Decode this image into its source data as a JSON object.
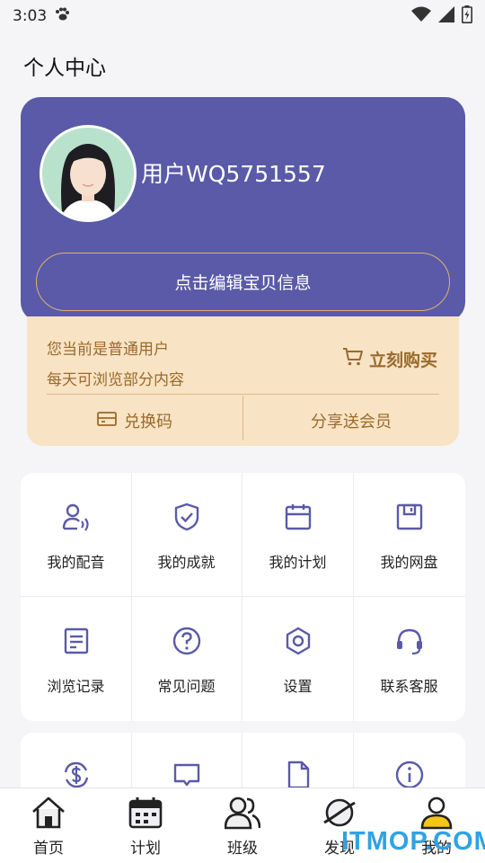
{
  "status_bar": {
    "time": "3:03"
  },
  "page": {
    "title": "个人中心"
  },
  "profile": {
    "username": "用户WQ5751557",
    "edit_button": "点击编辑宝贝信息"
  },
  "membership": {
    "status_line": "您当前是普通用户",
    "limit_line": "每天可浏览部分内容",
    "buy_label": "立刻购买",
    "redeem_label": "兑换码",
    "share_label": "分享送会员"
  },
  "menu_grid": [
    {
      "label": "我的配音",
      "icon": "dubbing-icon"
    },
    {
      "label": "我的成就",
      "icon": "shield-check-icon"
    },
    {
      "label": "我的计划",
      "icon": "calendar-icon"
    },
    {
      "label": "我的网盘",
      "icon": "save-disk-icon"
    },
    {
      "label": "浏览记录",
      "icon": "document-icon"
    },
    {
      "label": "常见问题",
      "icon": "question-icon"
    },
    {
      "label": "设置",
      "icon": "settings-hex-icon"
    },
    {
      "label": "联系客服",
      "icon": "headset-icon"
    }
  ],
  "menu_grid_2_icons": [
    "dollar-refresh-icon",
    "message-icon",
    "file-icon",
    "info-icon"
  ],
  "bottom_nav": [
    {
      "label": "首页",
      "icon": "home-icon"
    },
    {
      "label": "计划",
      "icon": "calendar-nav-icon"
    },
    {
      "label": "班级",
      "icon": "people-icon"
    },
    {
      "label": "发现",
      "icon": "planet-icon"
    },
    {
      "label": "我的",
      "icon": "user-icon",
      "active": true
    }
  ],
  "watermark": "ITMOP.COM",
  "colors": {
    "brand_purple": "#5a5aa9",
    "member_bg": "#f8e3c4",
    "member_text": "#9a6a2c",
    "active_tab": "#f5c518"
  }
}
